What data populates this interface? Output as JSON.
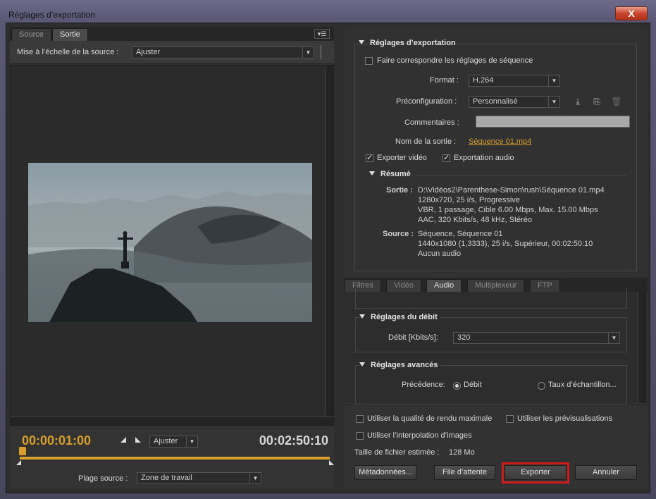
{
  "window": {
    "title": "Réglages d’exportation",
    "close_label": "X"
  },
  "left": {
    "tabs": [
      {
        "label": "Source"
      },
      {
        "label": "Sortie"
      }
    ],
    "panel_menu_icon": "▾☰",
    "scale_label": "Mise à l’échelle de la source :",
    "scale_value": "Ajuster",
    "timecode_current": "00:00:01:00",
    "timecode_duration": "00:02:50:10",
    "zoom_value": "Ajuster",
    "plage_label": "Plage source :",
    "plage_value": "Zone de travail"
  },
  "right": {
    "export_settings_title": "Réglages d’exportation",
    "match_sequence_label": "Faire correspondre les réglages de séquence",
    "format_label": "Format :",
    "format_value": "H.264",
    "preset_label": "Préconfiguration :",
    "preset_value": "Personnalisé",
    "comments_label": "Commentaires :",
    "output_name_label": "Nom de la sortie :",
    "output_name_value": "Séquence 01.mp4",
    "export_video_label": "Exporter vidéo",
    "export_audio_label": "Exportation audio",
    "summary_title": "Résumé",
    "output_key": "Sortie :",
    "output_lines": [
      "D:\\Vidéos2\\Parenthese-Simon\\rush\\Séquence 01.mp4",
      "1280x720, 25 i/s, Progressive",
      "VBR, 1 passage, Cible 6.00 Mbps, Max. 15.00 Mbps",
      "AAC, 320  Kbits/s, 48  kHz, Stéréo"
    ],
    "source_key": "Source :",
    "source_lines": [
      "Séquence, Séquence 01",
      "1440x1080 (1,3333), 25  i/s, Supérieur, 00:02:50:10",
      "Aucun audio"
    ],
    "tabs": [
      {
        "label": "Filtres"
      },
      {
        "label": "Vidéo"
      },
      {
        "label": "Audio"
      },
      {
        "label": "Multiplexeur"
      },
      {
        "label": "FTP"
      }
    ],
    "bitrate_section": "Réglages du débit",
    "bitrate_label": "Débit [Kbits/s]:",
    "bitrate_value": "320",
    "advanced_section": "Réglages avancés",
    "precedence_label": "Précédence:",
    "precedence_opt1": "Débit",
    "precedence_opt2": "Taux d’échantillon...",
    "max_quality_label": "Utiliser la qualité de rendu maximale",
    "previews_label": "Utiliser les prévisualisations",
    "interp_label": "Utiliser l’interpolation d’images",
    "filesize_label": "Taille de fichier estimée :",
    "filesize_value": "128 Mo",
    "metadata_button": "Métadonnées...",
    "queue_button": "File d’attente",
    "export_button": "Exporter",
    "cancel_button": "Annuler"
  },
  "colors": {
    "accent": "#d8a02a",
    "highlight": "#d21a1a"
  }
}
